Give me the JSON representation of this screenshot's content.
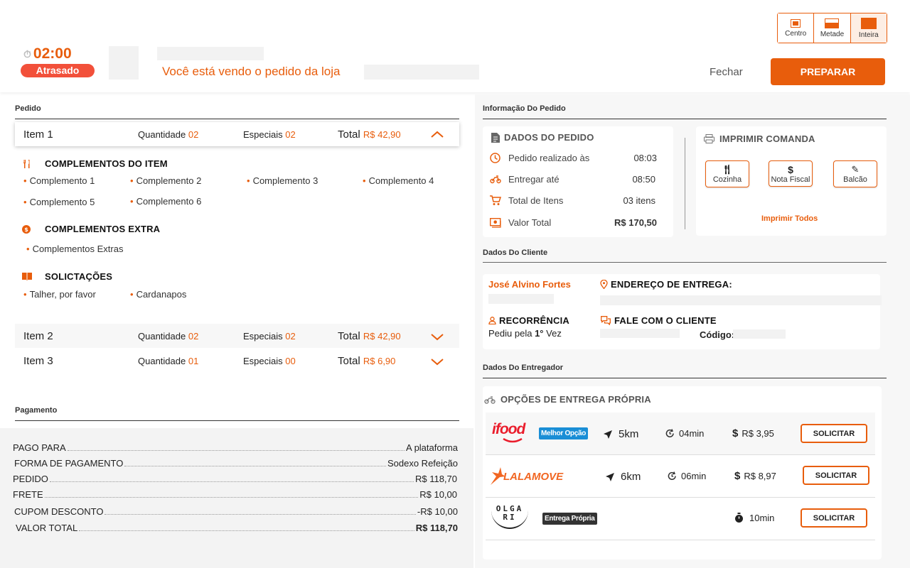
{
  "header": {
    "timer": "02:00",
    "late_badge": "Atrasado",
    "store_text": "Você está vendo o pedido da loja",
    "view_options": [
      "Centro",
      "Metade",
      "Inteira"
    ],
    "close_label": "Fechar",
    "prepare_label": "PREPARAR"
  },
  "order": {
    "section_title": "Pedido",
    "qty_label": "Quantidade",
    "specials_label": "Especiais",
    "total_label": "Total",
    "items": [
      {
        "name": "Item 1",
        "qty": "02",
        "specials": "02",
        "total": "R$ 42,90"
      },
      {
        "name": "Item 2",
        "qty": "02",
        "specials": "02",
        "total": "R$ 42,90"
      },
      {
        "name": "Item 3",
        "qty": "01",
        "specials": "00",
        "total": "R$ 6,90"
      }
    ],
    "complements_title": "COMPLEMENTOS DO ITEM",
    "complements": [
      "Complemento 1",
      "Complemento 2",
      "Complemento 3",
      "Complemento 4",
      "Complemento 5",
      "Complemento 6"
    ],
    "extras_title": "COMPLEMENTOS EXTRA",
    "extras": [
      "Complementos Extras"
    ],
    "requests_title": "SOLICTAÇÕES",
    "requests": [
      "Talher, por favor",
      "Cardanapos"
    ]
  },
  "payment": {
    "section_title": "Pagamento",
    "rows": [
      {
        "label": "PAGO PARA",
        "value": "A plataforma"
      },
      {
        "label": "FORMA DE PAGAMENTO",
        "value": "Sodexo Refeição"
      },
      {
        "label": "PEDIDO",
        "value": "R$ 118,70"
      },
      {
        "label": "FRETE",
        "value": "R$ 10,00"
      },
      {
        "label": "CUPOM DESCONTO",
        "value": "-R$ 10,00"
      },
      {
        "label": "VALOR TOTAL",
        "value": "R$ 118,70"
      }
    ]
  },
  "info": {
    "section_title": "Informação Do Pedido",
    "data_title": "DADOS DO PEDIDO",
    "rows": [
      {
        "label": "Pedido realizado às",
        "value": "08:03"
      },
      {
        "label": "Entregar até",
        "value": "08:50"
      },
      {
        "label": "Total de Itens",
        "value": "03 itens"
      },
      {
        "label": "Valor Total",
        "value": "R$ 170,50"
      }
    ],
    "print_title": "IMPRIMIR COMANDA",
    "print_buttons": [
      "Cozinha",
      "Nota Fiscal",
      "Balcão"
    ],
    "print_all": "Imprimir Todos"
  },
  "client": {
    "section_title": "Dados Do Cliente",
    "name": "José Alvino Fortes",
    "address_title": "ENDEREÇO DE ENTREGA:",
    "recurrence_title": "RECORRÊNCIA",
    "recurrence_text": "Pediu pela",
    "recurrence_count": "1°",
    "recurrence_suffix": "Vez",
    "contact_title": "FALE COM O CLIENTE",
    "code_label": "Código:"
  },
  "delivery": {
    "section_title": "Dados Do Entregador",
    "options_title": "OPÇÕES DE ENTREGA PRÓPRIA",
    "providers": [
      {
        "logo": "ifood",
        "badge": "Melhor Opção",
        "distance": "5km",
        "time": "04min",
        "price": "R$ 3,95",
        "action": "SOLICITAR"
      },
      {
        "logo": "LALAMOVE",
        "distance": "6km",
        "time": "06min",
        "price": "R$ 8,97",
        "action": "SOLICITAR"
      },
      {
        "logo_lines": [
          "OLGA",
          "RI"
        ],
        "badge": "Entrega Própria",
        "time": "10min",
        "action": "SOLICITAR"
      }
    ]
  },
  "colors": {
    "accent": "#e85d0c",
    "late": "#f2503a",
    "best_badge": "#1a8ed6",
    "own_badge": "#333333"
  }
}
